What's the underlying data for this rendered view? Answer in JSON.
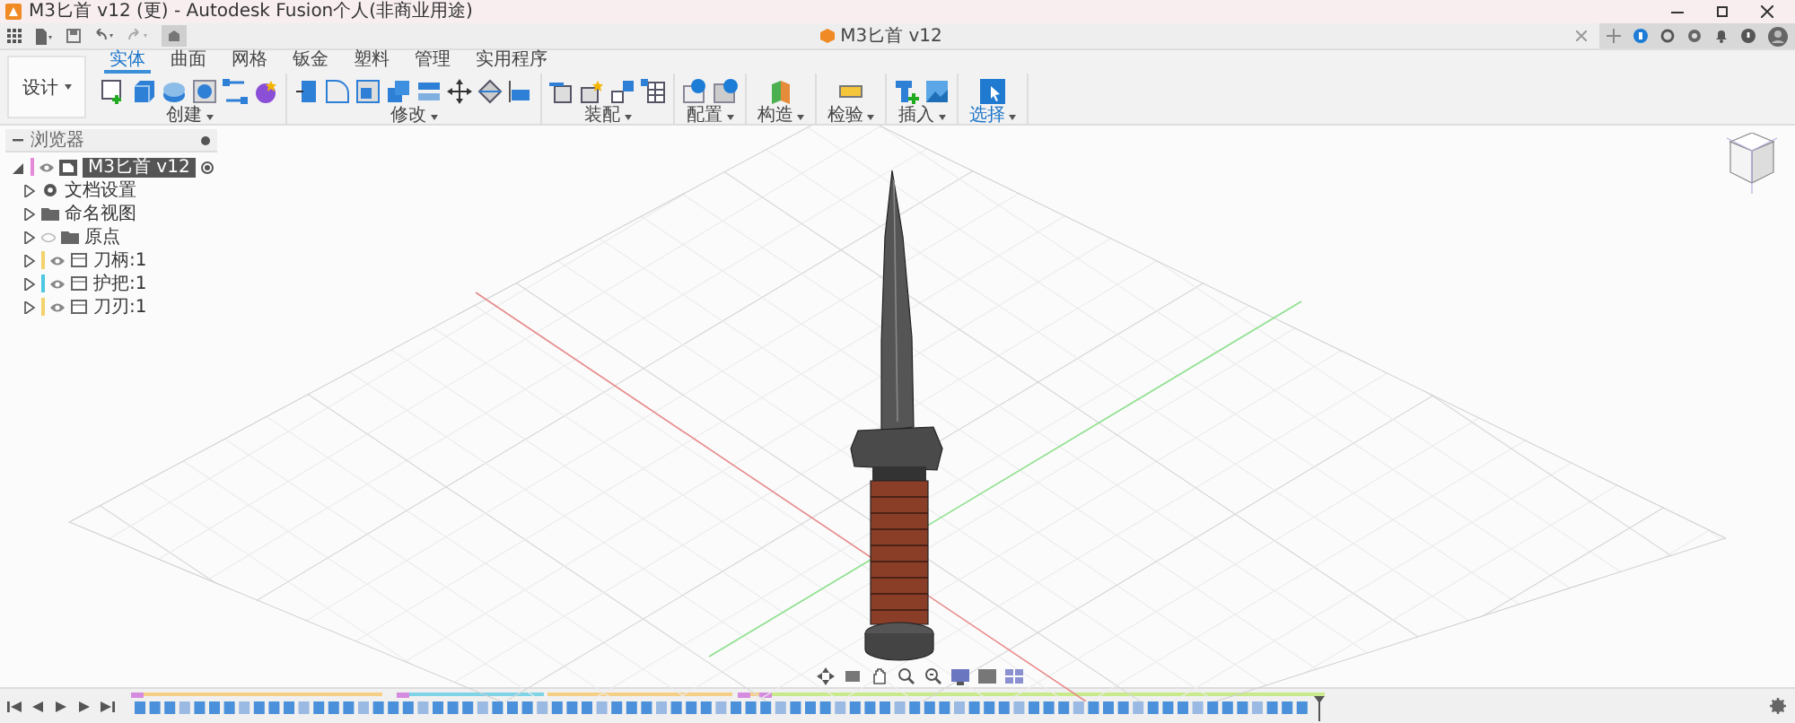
{
  "window": {
    "title": "M3匕首 v12 (更) - Autodesk Fusion个人(非商业用途)"
  },
  "document_tab": {
    "title": "M3匕首 v12"
  },
  "workspace_button": {
    "label": "设计"
  },
  "ribbon": {
    "tabs": [
      {
        "label": "实体",
        "selected": true
      },
      {
        "label": "曲面",
        "selected": false
      },
      {
        "label": "网格",
        "selected": false
      },
      {
        "label": "钣金",
        "selected": false
      },
      {
        "label": "塑料",
        "selected": false
      },
      {
        "label": "管理",
        "selected": false
      },
      {
        "label": "实用程序",
        "selected": false
      }
    ],
    "groups": [
      {
        "label": "创建",
        "selected": false
      },
      {
        "label": "修改",
        "selected": false
      },
      {
        "label": "装配",
        "selected": false
      },
      {
        "label": "配置",
        "selected": false
      },
      {
        "label": "构造",
        "selected": false
      },
      {
        "label": "检验",
        "selected": false
      },
      {
        "label": "插入",
        "selected": false
      },
      {
        "label": "选择",
        "selected": true
      }
    ]
  },
  "browser": {
    "title": "浏览器",
    "root": {
      "label": "M3匕首 v12",
      "expanded": true,
      "visible": true,
      "color": "#e48ad8",
      "children": [
        {
          "label": "文档设置",
          "kind": "settings",
          "expanded": false
        },
        {
          "label": "命名视图",
          "kind": "folder",
          "expanded": false
        },
        {
          "label": "原点",
          "kind": "folder",
          "expanded": false,
          "visible": false
        },
        {
          "label": "刀柄:1",
          "kind": "component",
          "expanded": false,
          "visible": true,
          "color": "#f2d26a"
        },
        {
          "label": "护把:1",
          "kind": "component",
          "expanded": false,
          "visible": true,
          "color": "#4cc8e0"
        },
        {
          "label": "刀刃:1",
          "kind": "component",
          "expanded": false,
          "visible": true,
          "color": "#f2d26a"
        }
      ]
    }
  }
}
